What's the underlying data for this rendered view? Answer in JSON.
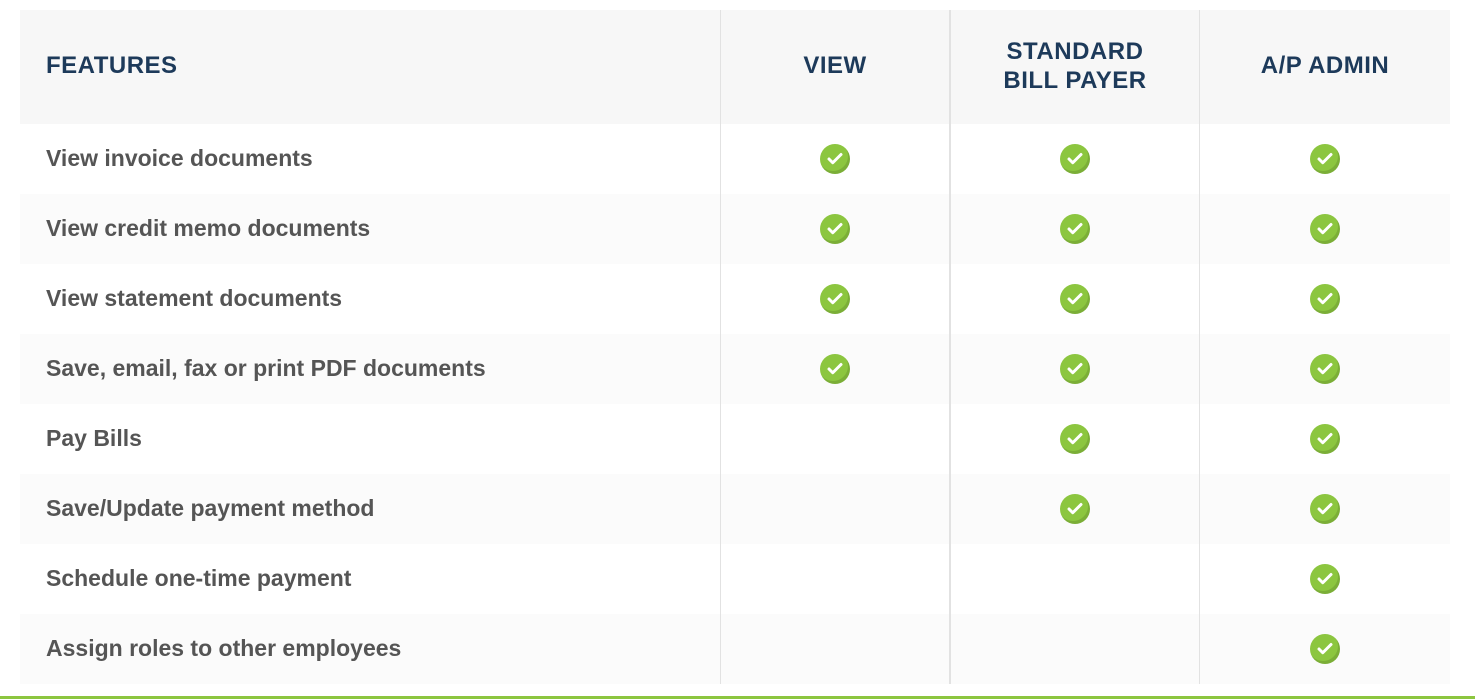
{
  "table": {
    "headers": [
      "FEATURES",
      "VIEW",
      "STANDARD BILL PAYER",
      "A/P ADMIN"
    ],
    "rows": [
      {
        "feature": "View invoice documents",
        "cols": [
          true,
          true,
          true
        ]
      },
      {
        "feature": "View credit memo documents",
        "cols": [
          true,
          true,
          true
        ]
      },
      {
        "feature": "View statement documents",
        "cols": [
          true,
          true,
          true
        ]
      },
      {
        "feature": "Save, email, fax or print PDF documents",
        "cols": [
          true,
          true,
          true
        ]
      },
      {
        "feature": "Pay Bills",
        "cols": [
          false,
          true,
          true
        ]
      },
      {
        "feature": "Save/Update payment method",
        "cols": [
          false,
          true,
          true
        ]
      },
      {
        "feature": "Schedule one-time payment",
        "cols": [
          false,
          false,
          true
        ]
      },
      {
        "feature": "Assign roles to other employees",
        "cols": [
          false,
          false,
          true
        ]
      }
    ]
  }
}
